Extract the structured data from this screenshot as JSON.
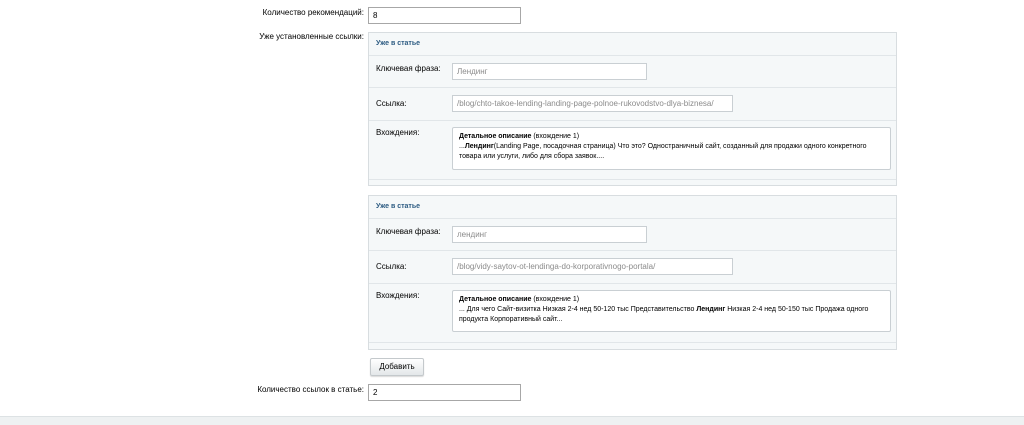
{
  "form": {
    "recommendations_label": "Количество рекомендаций:",
    "recommendations_value": "8",
    "installed_links_label": "Уже установленные ссылки:",
    "add_button": "Добавить",
    "links_count_label": "Количество ссылок в статье:",
    "links_count_value": "2"
  },
  "cards": [
    {
      "title": "Уже в статье",
      "keyphrase_label": "Ключевая фраза:",
      "keyphrase_value": "Лендинг",
      "link_label": "Ссылка:",
      "link_value": "/blog/chto-takoe-lending-landing-page-polnoe-rukovodstvo-dlya-biznesa/",
      "occurrences_label": "Вхождения:",
      "occ_title": "Детальное описание",
      "occ_suffix": " (вхождение 1)",
      "occ_pre": "...",
      "occ_keyword": "Лендинг",
      "occ_post": "(Landing Page, посадочная страница) Что это?  Одностраничный сайт, созданный для продажи одного конкретного товара или услуги, либо для сбора заявок...."
    },
    {
      "title": "Уже в статье",
      "keyphrase_label": "Ключевая фраза:",
      "keyphrase_value": "лендинг",
      "link_label": "Ссылка:",
      "link_value": "/blog/vidy-saytov-ot-lendinga-do-korporativnogo-portala/",
      "occurrences_label": "Вхождения:",
      "occ_title": "Детальное описание",
      "occ_suffix": " (вхождение 1)",
      "occ_pre": "...  Для чего  Сайт-визитка  Низкая  2-4 нед  50-120 тыс  Представительство  ",
      "occ_keyword": "Лендинг",
      "occ_post": " Низкая  2-4 нед  50-150 тыс  Продажа одного продукта  Корпоративный сайт..."
    }
  ]
}
